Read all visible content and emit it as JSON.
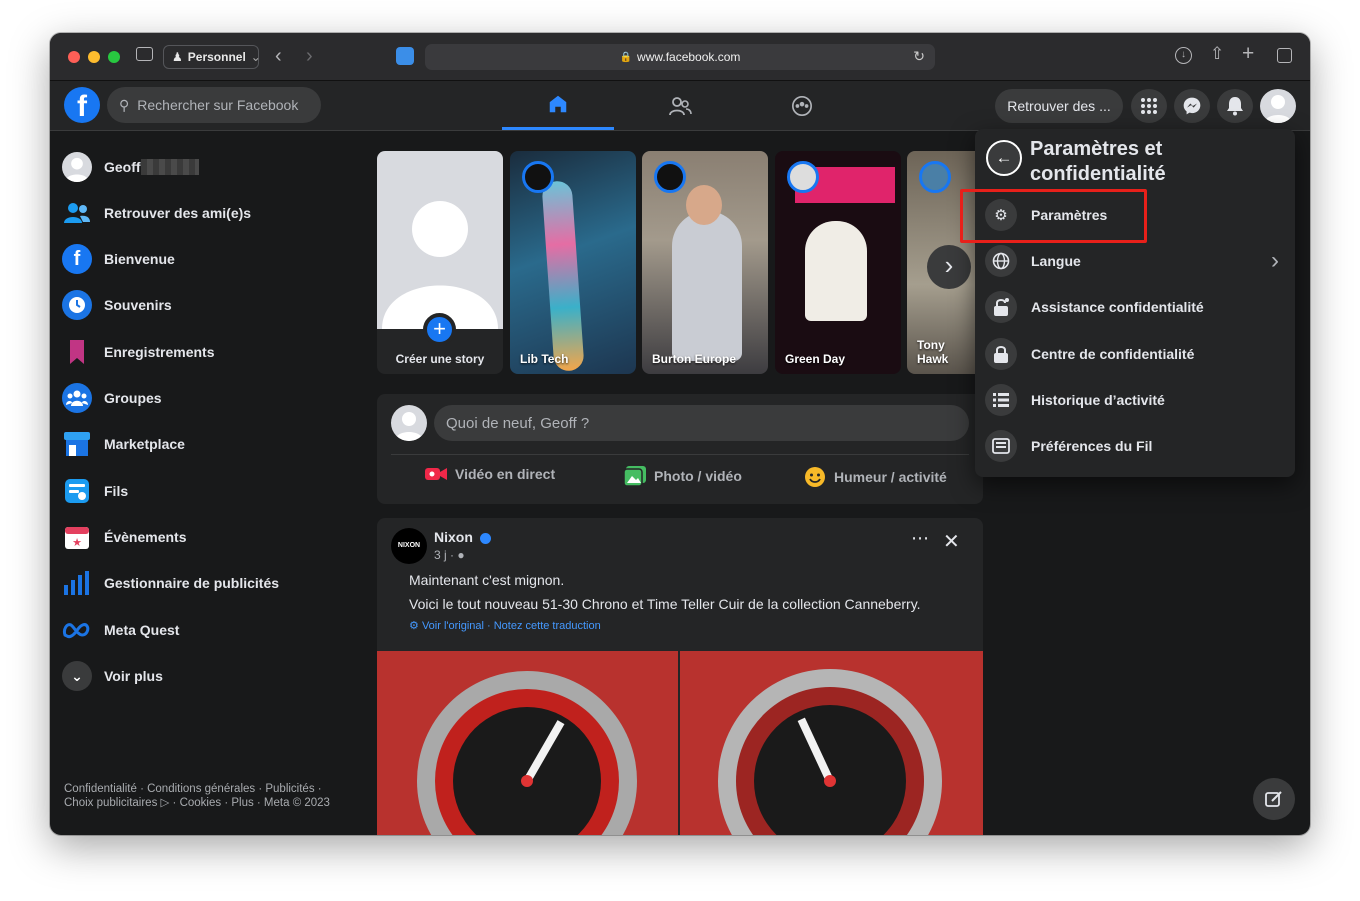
{
  "browser": {
    "profile_label": "Personnel",
    "url": "www.facebook.com",
    "toolbar_icons": [
      "sidebar-icon",
      "back-icon",
      "forward-icon",
      "reload-icon",
      "download-icon",
      "share-icon",
      "new-tab-icon",
      "tabs-icon"
    ]
  },
  "header": {
    "search_placeholder": "Rechercher sur Facebook",
    "find_friends_label": "Retrouver des ...",
    "nav_tabs": [
      "home-icon",
      "friends-icon",
      "groups-icon"
    ]
  },
  "sidebar": {
    "items": [
      {
        "label": "Geoff",
        "icon": "avatar"
      },
      {
        "label": "Retrouver des ami(e)s",
        "icon": "friends-icon"
      },
      {
        "label": "Bienvenue",
        "icon": "facebook-icon"
      },
      {
        "label": "Souvenirs",
        "icon": "clock-icon"
      },
      {
        "label": "Enregistrements",
        "icon": "bookmark-icon"
      },
      {
        "label": "Groupes",
        "icon": "groups-icon"
      },
      {
        "label": "Marketplace",
        "icon": "shop-icon"
      },
      {
        "label": "Fils",
        "icon": "feeds-icon"
      },
      {
        "label": "Évènements",
        "icon": "calendar-icon"
      },
      {
        "label": "Gestionnaire de publicités",
        "icon": "ads-chart-icon"
      },
      {
        "label": "Meta Quest",
        "icon": "meta-icon"
      },
      {
        "label": "Voir plus",
        "icon": "chevron-down-icon"
      }
    ],
    "footer": "Confidentialité · Conditions générales · Publicités · Choix publicitaires ▷ · Cookies · Plus · Meta © 2023"
  },
  "stories": {
    "create_label": "Créer une story",
    "items": [
      {
        "name": "Lib Tech"
      },
      {
        "name": "Burton Europe"
      },
      {
        "name": "Green Day"
      },
      {
        "name": "Tony Hawk"
      }
    ]
  },
  "composer": {
    "placeholder": "Quoi de neuf, Geoff ?",
    "actions": [
      "Vidéo en direct",
      "Photo / vidéo",
      "Humeur / activité"
    ]
  },
  "post": {
    "author": "Nixon",
    "time": "3 j ·",
    "line1": "Maintenant c'est mignon.",
    "line2": "Voici le tout nouveau 51-30 Chrono et Time Teller Cuir de la collection Canneberry.",
    "translation_note": "Voir l'original · Notez cette traduction",
    "brand_logo_text": "NIXON"
  },
  "settings_menu": {
    "title": "Paramètres et confidentialité",
    "items": [
      {
        "label": "Paramètres",
        "icon": "gear-icon"
      },
      {
        "label": "Langue",
        "icon": "globe-icon"
      },
      {
        "label": "Assistance confidentialité",
        "icon": "lock-assist-icon"
      },
      {
        "label": "Centre de confidentialité",
        "icon": "lock-icon"
      },
      {
        "label": "Historique d’activité",
        "icon": "list-icon"
      },
      {
        "label": "Préférences du Fil",
        "icon": "feed-prefs-icon"
      }
    ]
  },
  "colors": {
    "accent": "#1877f2",
    "highlight_box": "#e8201a"
  }
}
